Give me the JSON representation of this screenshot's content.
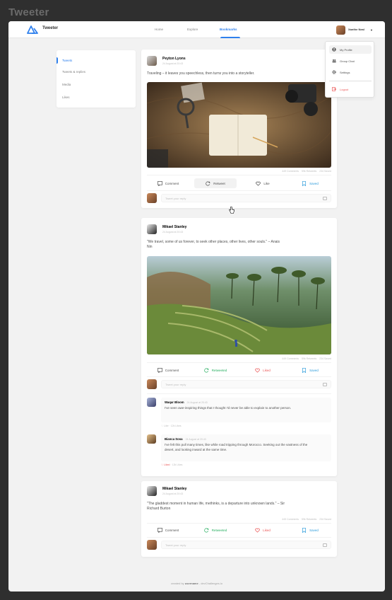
{
  "app_title": "Tweeter",
  "header": {
    "brand": "Tweeter",
    "nav": [
      {
        "label": "Home"
      },
      {
        "label": "Explore"
      },
      {
        "label": "Bookmarks"
      }
    ],
    "user_name": "Xanthe Neal"
  },
  "sidebar": {
    "items": [
      {
        "label": "Tweets"
      },
      {
        "label": "Tweets & replies"
      },
      {
        "label": "Media"
      },
      {
        "label": "Likes"
      }
    ]
  },
  "dropdown": {
    "items": [
      {
        "label": "My Profile",
        "icon": "user-circle-icon"
      },
      {
        "label": "Group Chat",
        "icon": "group-icon"
      },
      {
        "label": "Settings",
        "icon": "gear-icon"
      },
      {
        "label": "Logout",
        "icon": "logout-icon"
      }
    ]
  },
  "posts": [
    {
      "author": "Peyton Lyons",
      "date": "24 August at 20:43",
      "text": "Traveling – it leaves you speechless, then turns you into a storyteller.",
      "stats": {
        "comments": "449 Comments",
        "retweets": "59k Retweets",
        "saved": "234 Saved"
      },
      "actions": {
        "comment": "Comment",
        "retweet": "Retweet",
        "like": "Like",
        "save": "Saved"
      },
      "reply_placeholder": "Tweet your reply"
    },
    {
      "author": "Mikael Stanley",
      "date": "24 August at 20:43",
      "text": "\"We travel, some of us forever, to seek other places, other lives, other souls.\" – Anais Nin",
      "stats": {
        "comments": "449 Comments",
        "retweets": "59k Retweets",
        "saved": "234 Saved"
      },
      "actions": {
        "comment": "Comment",
        "retweet": "Retweeted",
        "like": "Liked",
        "save": "Saved"
      },
      "reply_placeholder": "Tweet your reply",
      "comments": [
        {
          "author": "Waqar Bloom",
          "date": "24 August at 20:43",
          "text": "I've seen awe-inspiring things that I thought I'd never be able to explain to another person.",
          "like_label": "Like",
          "likes": "12k Likes"
        },
        {
          "author": "Bianca Sosa",
          "date": "24 August at 20:43",
          "text": "I've felt this pull many times, like while road tripping through Morocco. Seeking out the vastness of the desert, and looking inward at the same time.",
          "like_label": "Liked",
          "likes": "12k Likes"
        }
      ]
    },
    {
      "author": "Mikael Stanley",
      "date": "24 August at 20:43",
      "text": "\"The gladdest moment in human life, methinks, is a departure into unknown lands.\" – Sir Richard Burton",
      "stats": {
        "comments": "449 Comments",
        "retweets": "59k Retweets",
        "saved": "234 Saved"
      },
      "actions": {
        "comment": "Comment",
        "retweet": "Retweeted",
        "like": "Liked",
        "save": "Saved"
      },
      "reply_placeholder": "Tweet your reply"
    }
  ],
  "footer": {
    "prefix": "created by",
    "user": "username",
    "suffix": "- devChallenges.io"
  },
  "colors": {
    "accent": "#2f80ed",
    "green": "#27ae60",
    "red": "#eb5757",
    "saved": "#2d9cdb"
  }
}
